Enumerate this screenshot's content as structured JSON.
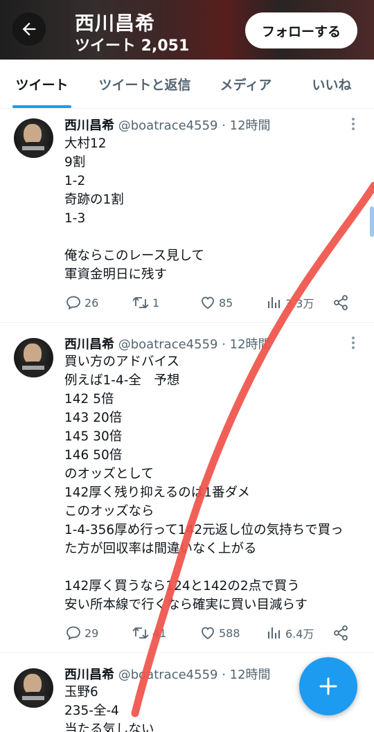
{
  "header": {
    "title": "西川昌希",
    "subtitle": "ツイート 2,051",
    "follow_label": "フォローする"
  },
  "tabs": [
    {
      "label": "ツイート",
      "active": true
    },
    {
      "label": "ツイートと返信",
      "active": false
    },
    {
      "label": "メディア",
      "active": false
    },
    {
      "label": "いいね",
      "active": false
    }
  ],
  "tweets": [
    {
      "name": "西川昌希",
      "handle_time": "@boatrace4559 · 12時間",
      "lines": [
        "大村12",
        "9割",
        "1-2",
        "奇跡の1割",
        "1-3",
        "",
        "俺ならこのレース見して",
        "軍資金明日に残す"
      ],
      "replies": "26",
      "retweets": "1",
      "likes": "85",
      "views": "3.3万"
    },
    {
      "name": "西川昌希",
      "handle_time": "@boatrace4559 · 12時間",
      "lines": [
        "買い方のアドバイス",
        "例えば1-4-全　予想",
        "142 5倍",
        "143 20倍",
        "145 30倍",
        "146 50倍",
        "のオッズとして",
        "142厚く残り抑えるのは1番ダメ",
        "このオッズなら",
        "1-4-356厚め行って142元返し位の気持ちで買っ",
        "た方が回収率は間違いなく上がる",
        "",
        "142厚く買うなら124と142の2点で買う",
        "安い所本線で行くなら確実に買い目減らす"
      ],
      "replies": "29",
      "retweets": "41",
      "likes": "588",
      "views": "6.4万"
    },
    {
      "name": "西川昌希",
      "handle_time": "@boatrace4559 · 12時間",
      "lines": [
        "玉野6",
        "235-全-4",
        "当たる気しない"
      ]
    }
  ],
  "colors": {
    "accent": "#1d9bf0",
    "text_primary": "#0f1419",
    "text_secondary": "#536471",
    "annotation_stroke": "#f0524a"
  },
  "icons": [
    "back-arrow-icon",
    "more-icon",
    "reply-icon",
    "retweet-icon",
    "like-icon",
    "views-icon",
    "share-icon",
    "compose-plus-icon"
  ]
}
